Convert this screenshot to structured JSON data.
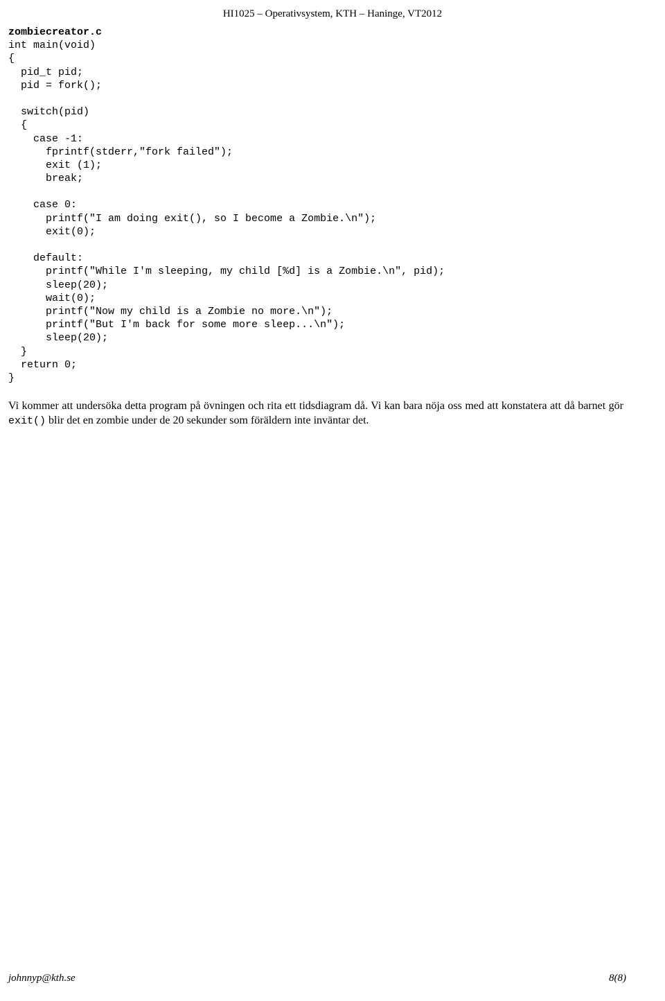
{
  "header": "HI1025 – Operativsystem, KTH – Haninge, VT2012",
  "code": {
    "title": "zombiecreator.c",
    "lines": [
      "int main(void)",
      "{",
      "  pid_t pid;",
      "  pid = fork();",
      "",
      "  switch(pid)",
      "  {",
      "    case -1:",
      "      fprintf(stderr,\"fork failed\");",
      "      exit (1);",
      "      break;",
      "",
      "    case 0:",
      "      printf(\"I am doing exit(), so I become a Zombie.\\n\");",
      "      exit(0);",
      "",
      "    default:",
      "      printf(\"While I'm sleeping, my child [%d] is a Zombie.\\n\", pid);",
      "      sleep(20);",
      "      wait(0);",
      "      printf(\"Now my child is a Zombie no more.\\n\");",
      "      printf(\"But I'm back for some more sleep...\\n\");",
      "      sleep(20);",
      "  }",
      "  return 0;",
      "}"
    ]
  },
  "paragraph": {
    "part1": "Vi kommer att undersöka detta program på övningen och rita ett tidsdiagram då. Vi kan bara nöja oss med att konstatera att då barnet gör ",
    "code_inline": "exit()",
    "part2": " blir det en zombie under de 20 sekunder som föräldern inte inväntar det."
  },
  "footer": {
    "email": "johnnyp@kth.se",
    "page": "8(8)"
  }
}
